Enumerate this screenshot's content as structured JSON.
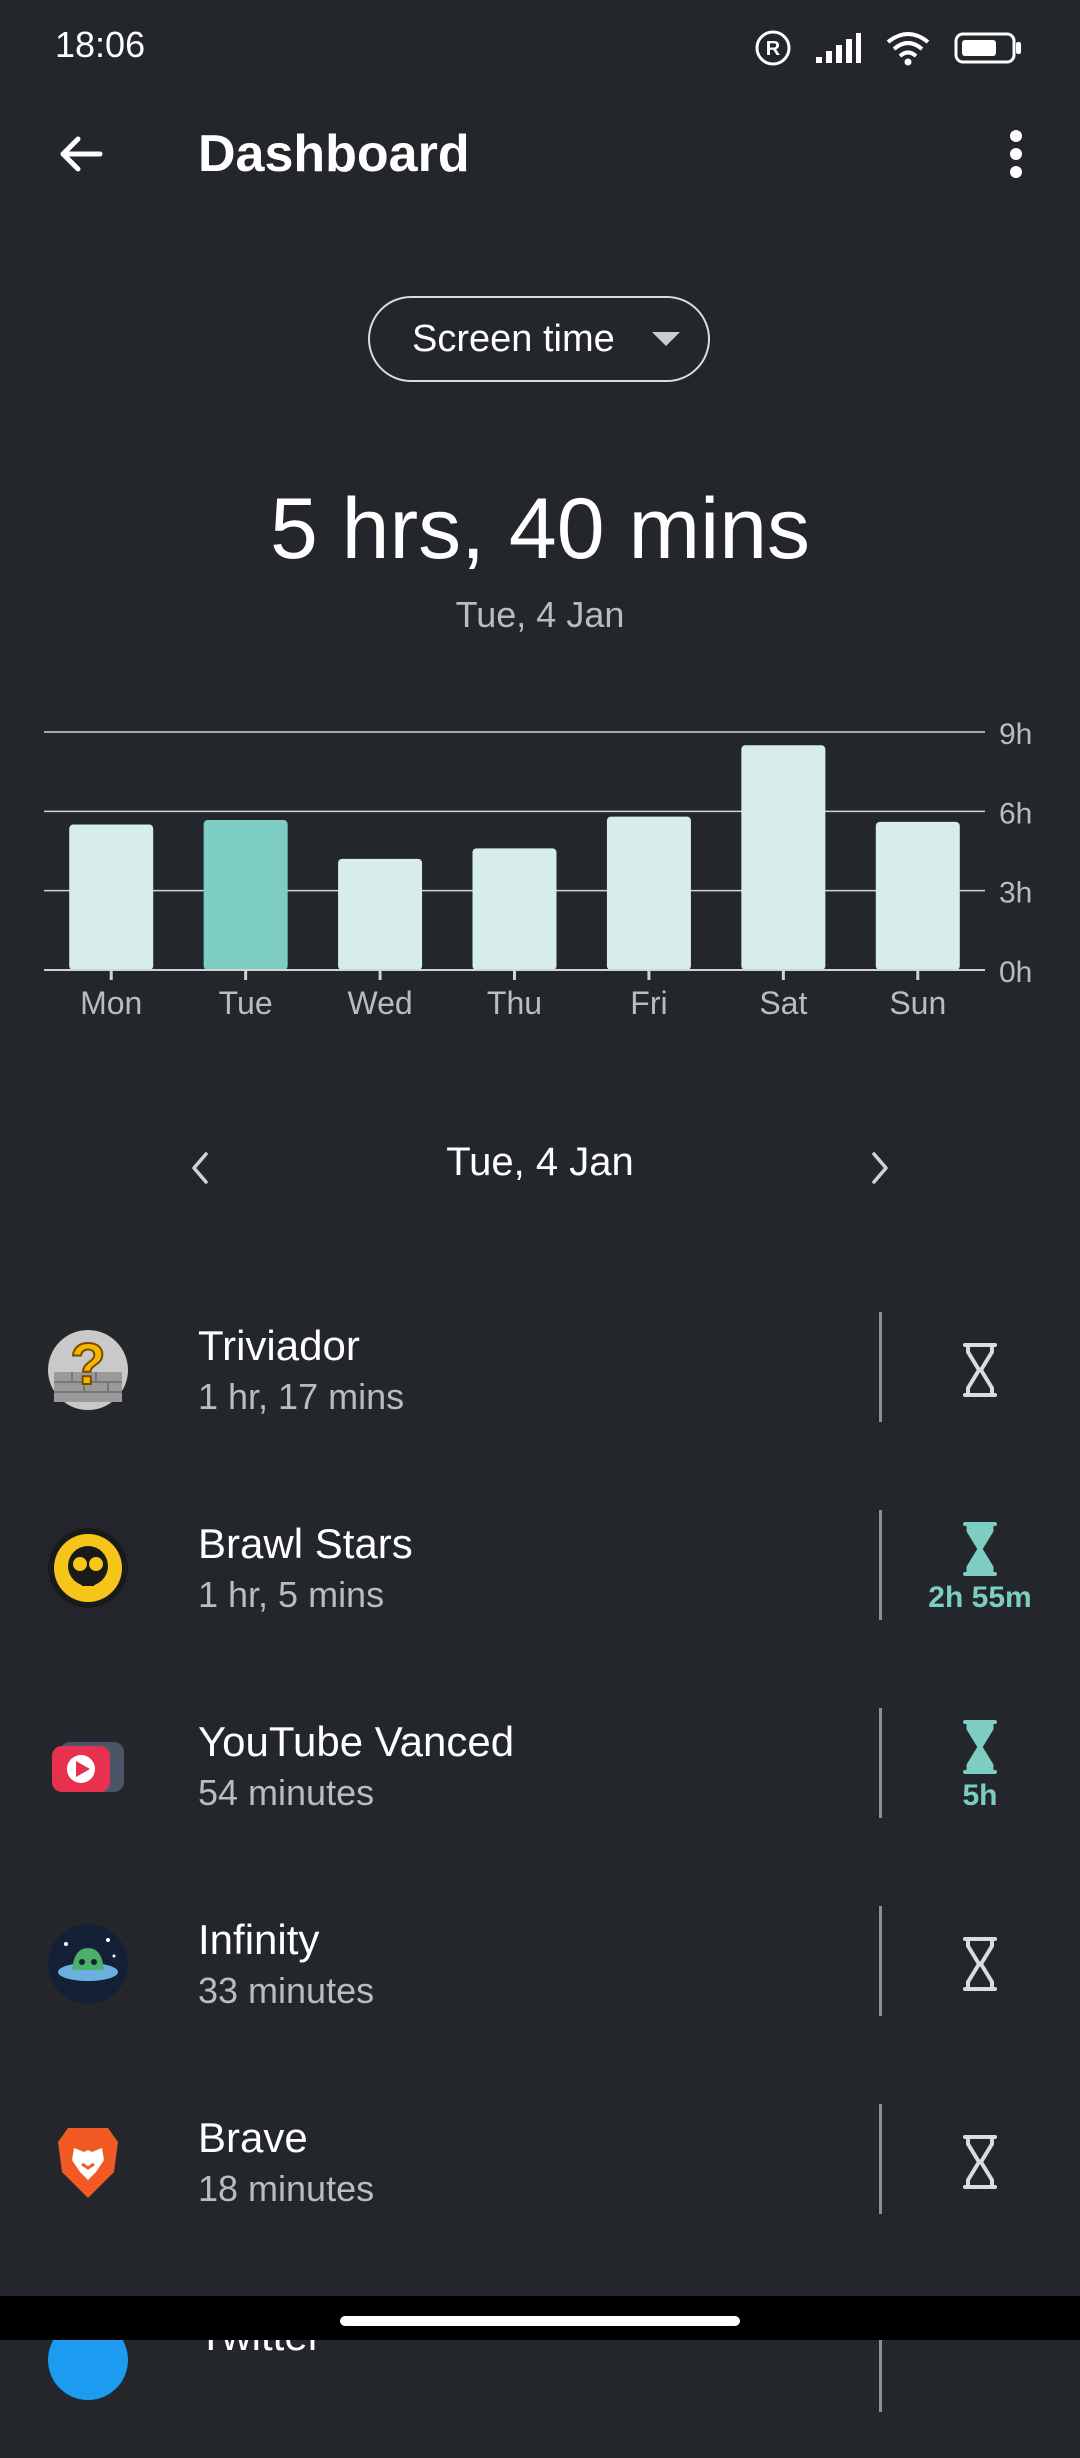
{
  "status_bar": {
    "time": "18:06",
    "icons": [
      "registered-icon",
      "signal-icon",
      "wifi-icon",
      "battery-icon"
    ]
  },
  "app_bar": {
    "title": "Dashboard",
    "back_icon": "arrow-left-icon",
    "menu_icon": "more-vertical-icon"
  },
  "metric_selector": {
    "value": "Screen time"
  },
  "summary": {
    "total": "5 hrs, 40 mins",
    "date": "Tue, 4 Jan"
  },
  "chart_data": {
    "type": "bar",
    "categories": [
      "Mon",
      "Tue",
      "Wed",
      "Thu",
      "Fri",
      "Sat",
      "Sun"
    ],
    "values": [
      5.5,
      5.67,
      4.2,
      4.6,
      5.8,
      8.5,
      5.6
    ],
    "ylim": [
      0,
      9
    ],
    "yticks": [
      "0h",
      "3h",
      "6h",
      "9h"
    ],
    "highlight_index": 1,
    "colors": {
      "bar": "#d6ede9",
      "highlight": "#7ecdc2",
      "grid": "#d0d4d8",
      "label": "#b9bdc2"
    },
    "grid": true
  },
  "date_nav": {
    "label": "Tue, 4 Jan",
    "prev_icon": "chevron-left-icon",
    "next_icon": "chevron-right-icon"
  },
  "apps": [
    {
      "name": "Triviador",
      "usage": "1 hr, 17 mins",
      "timer": "",
      "timer_active": false,
      "icon": "triviador-icon"
    },
    {
      "name": "Brawl Stars",
      "usage": "1 hr, 5 mins",
      "timer": "2h 55m",
      "timer_active": true,
      "icon": "brawl-stars-icon"
    },
    {
      "name": "YouTube Vanced",
      "usage": "54 minutes",
      "timer": "5h",
      "timer_active": true,
      "icon": "youtube-vanced-icon"
    },
    {
      "name": "Infinity",
      "usage": "33 minutes",
      "timer": "",
      "timer_active": false,
      "icon": "infinity-icon"
    },
    {
      "name": "Brave",
      "usage": "18 minutes",
      "timer": "",
      "timer_active": false,
      "icon": "brave-icon"
    }
  ],
  "partial_app": {
    "name": "Twitter"
  },
  "colors": {
    "background": "#23262b",
    "accent": "#7ecdc2",
    "muted_text": "#b9bdc2"
  }
}
